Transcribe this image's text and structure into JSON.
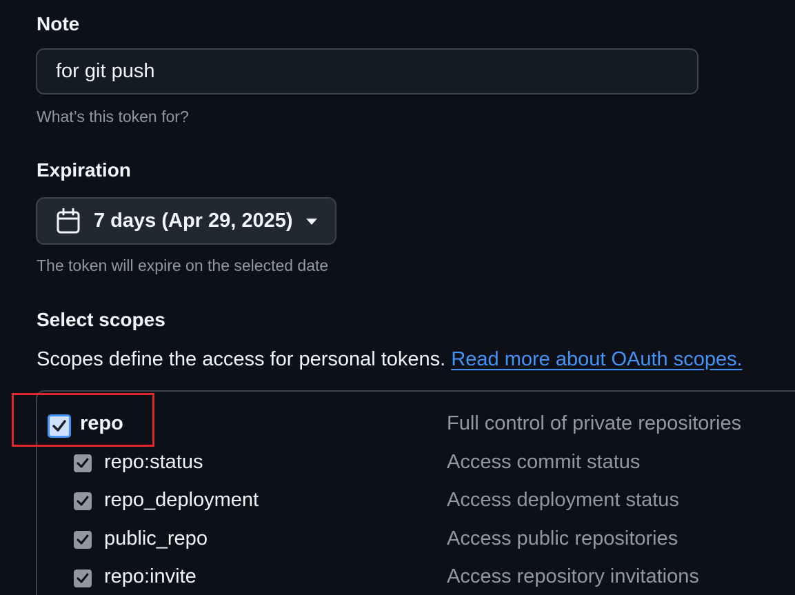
{
  "note": {
    "label": "Note",
    "value": "for git push",
    "hint": "What’s this token for?"
  },
  "expiration": {
    "label": "Expiration",
    "selected": "7 days (Apr 29, 2025)",
    "icon": "calendar-icon",
    "hint": "The token will expire on the selected date"
  },
  "scopes": {
    "heading": "Select scopes",
    "description": "Scopes define the access for personal tokens.",
    "link_text": "Read more about OAuth scopes.",
    "items": [
      {
        "name": "repo",
        "description": "Full control of private repositories",
        "checked": true
      },
      {
        "name": "repo:status",
        "description": "Access commit status",
        "checked": true
      },
      {
        "name": "repo_deployment",
        "description": "Access deployment status",
        "checked": true
      },
      {
        "name": "public_repo",
        "description": "Access public repositories",
        "checked": true
      },
      {
        "name": "repo:invite",
        "description": "Access repository invitations",
        "checked": true
      }
    ]
  },
  "colors": {
    "background": "#0d1117",
    "accent": "#4493f8",
    "highlight": "#e0262e",
    "muted_text": "#9198a1"
  }
}
